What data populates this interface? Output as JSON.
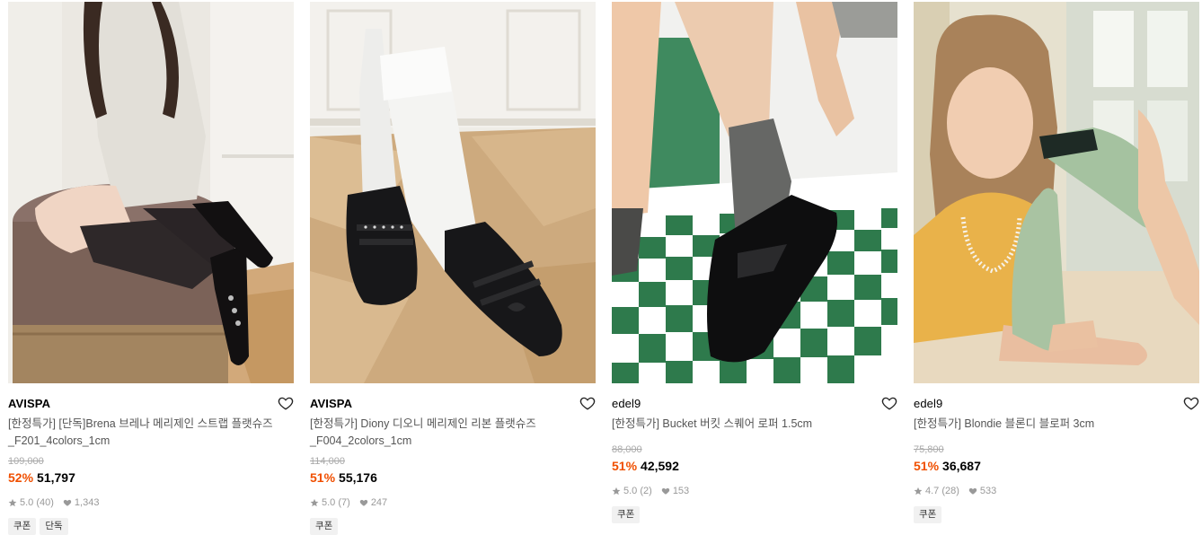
{
  "products": [
    {
      "brand": "AVISPA",
      "title": "[한정특가] [단독]Brena 브레나 메리제인 스트랩 플랫슈즈 _F201_4colors_1cm",
      "original_price": "109,000",
      "discount": "52%",
      "price": "51,797",
      "rating": "5.0",
      "reviews": "(40)",
      "likes": "1,343",
      "tags": [
        "쿠폰",
        "단독"
      ]
    },
    {
      "brand": "AVISPA",
      "title": "[한정특가] Diony 디오니 메리제인 리본 플랫슈즈 _F004_2colors_1cm",
      "original_price": "114,000",
      "discount": "51%",
      "price": "55,176",
      "rating": "5.0",
      "reviews": "(7)",
      "likes": "247",
      "tags": [
        "쿠폰"
      ]
    },
    {
      "brand": "edel9",
      "title": "[한정특가] Bucket 버킷 스퀘어 로퍼 1.5cm",
      "original_price": "88,000",
      "discount": "51%",
      "price": "42,592",
      "rating": "5.0",
      "reviews": "(2)",
      "likes": "153",
      "tags": [
        "쿠폰"
      ]
    },
    {
      "brand": "edel9",
      "title": "[한정특가] Blondie 블론디 블로퍼 3cm",
      "original_price": "75,800",
      "discount": "51%",
      "price": "36,687",
      "rating": "4.7",
      "reviews": "(28)",
      "likes": "533",
      "tags": [
        "쿠폰"
      ]
    }
  ],
  "icons": {
    "wishlist": "heart-outline-icon",
    "rating": "star-icon",
    "likes": "heart-filled-icon"
  },
  "colors": {
    "discount": "#f04f00",
    "muted": "#999999",
    "tag_bg": "#f1f1f1"
  }
}
